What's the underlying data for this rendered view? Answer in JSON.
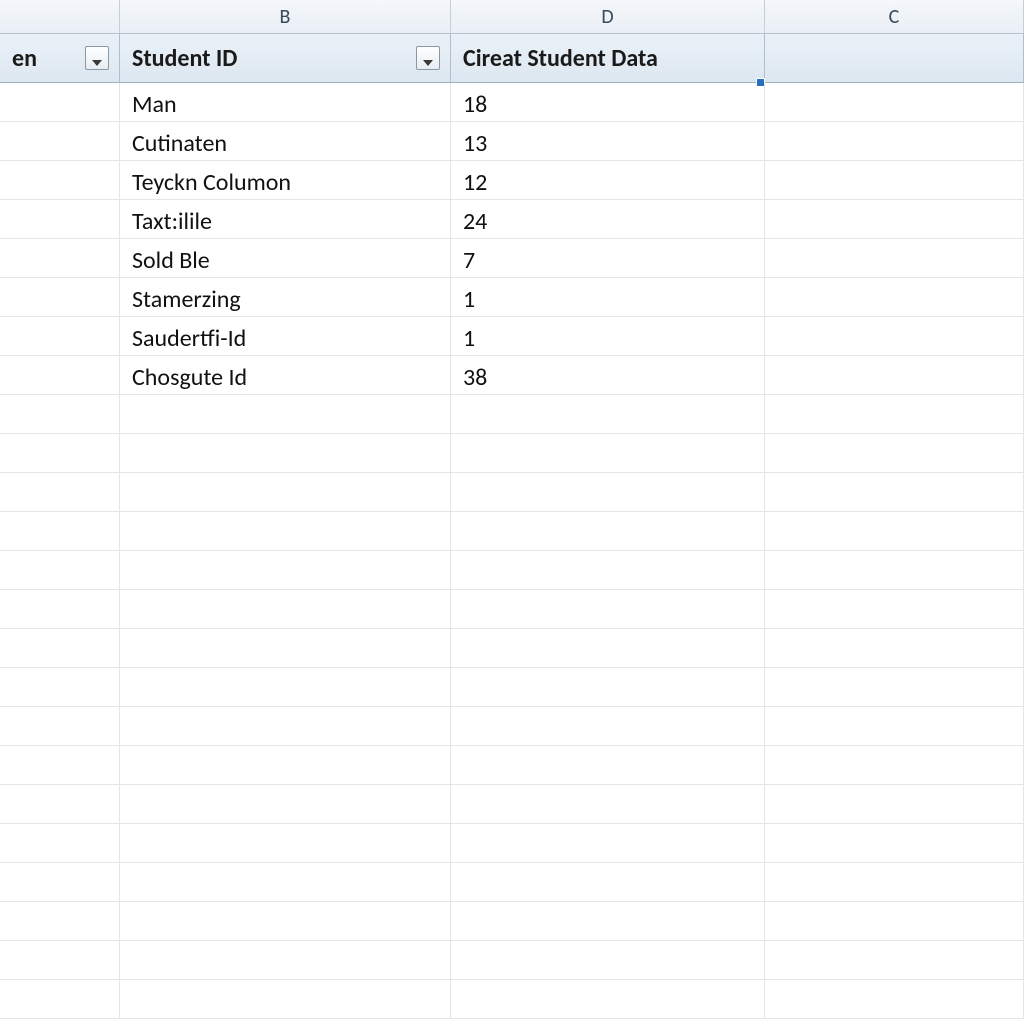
{
  "columns": {
    "letters": [
      "",
      "B",
      "D",
      "C"
    ],
    "headers": [
      {
        "label": "en",
        "has_filter": true
      },
      {
        "label": "Student ID",
        "has_filter": true
      },
      {
        "label": "Cireat Student Data",
        "has_filter": false
      }
    ]
  },
  "rows": [
    {
      "b": "Man",
      "d": "18"
    },
    {
      "b": "Cutinaten",
      "d": "13"
    },
    {
      "b": "Teyckn Columon",
      "d": "12"
    },
    {
      "b": "Taxt:ilile",
      "d": "24"
    },
    {
      "b": "Sold Ble",
      "d": " 7"
    },
    {
      "b": "Stamerzing",
      "d": " 1"
    },
    {
      "b": "Saudertfi-Id",
      "d": "1"
    },
    {
      "b": "Chosgute Id",
      "d": "38"
    }
  ],
  "chart_data": {
    "type": "table",
    "columns": [
      "Student ID",
      "Cireat Student Data"
    ],
    "data": [
      [
        "Man",
        18
      ],
      [
        "Cutinaten",
        13
      ],
      [
        "Teyckn Columon",
        12
      ],
      [
        "Taxt:ilile",
        24
      ],
      [
        "Sold Ble",
        7
      ],
      [
        "Stamerzing",
        1
      ],
      [
        "Saudertfi-Id",
        1
      ],
      [
        "Chosgute Id",
        38
      ]
    ]
  }
}
